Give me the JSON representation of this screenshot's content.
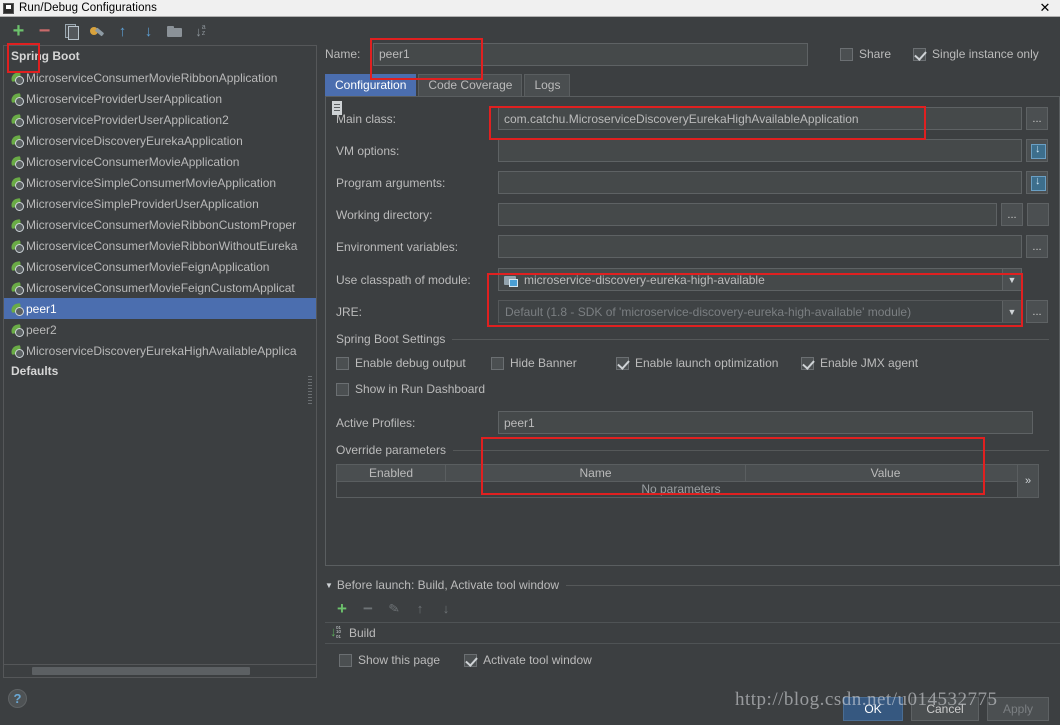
{
  "window": {
    "title": "Run/Debug Configurations",
    "close_label": "✕",
    "icon": "app-icon"
  },
  "sidebar": {
    "toolbar": [
      {
        "name": "add-configuration",
        "glyph": "+"
      },
      {
        "name": "remove-configuration",
        "glyph": "−"
      },
      {
        "name": "copy-configuration",
        "glyph": ""
      },
      {
        "name": "edit-templates",
        "glyph": ""
      },
      {
        "name": "move-up",
        "glyph": "↑"
      },
      {
        "name": "move-down",
        "glyph": "↓"
      },
      {
        "name": "create-folder",
        "glyph": ""
      },
      {
        "name": "sort-configurations",
        "glyph": "↓"
      }
    ],
    "groups": [
      {
        "label": "Spring Boot",
        "items": [
          {
            "label": "MicroserviceConsumerMovieRibbonApplication",
            "selected": false
          },
          {
            "label": "MicroserviceProviderUserApplication",
            "selected": false
          },
          {
            "label": "MicroserviceProviderUserApplication2",
            "selected": false
          },
          {
            "label": "MicroserviceDiscoveryEurekaApplication",
            "selected": false
          },
          {
            "label": "MicroserviceConsumerMovieApplication",
            "selected": false
          },
          {
            "label": "MicroserviceSimpleConsumerMovieApplication",
            "selected": false
          },
          {
            "label": "MicroserviceSimpleProviderUserApplication",
            "selected": false
          },
          {
            "label": "MicroserviceConsumerMovieRibbonCustomProper",
            "selected": false
          },
          {
            "label": "MicroserviceConsumerMovieRibbonWithoutEureka",
            "selected": false
          },
          {
            "label": "MicroserviceConsumerMovieFeignApplication",
            "selected": false
          },
          {
            "label": "MicroserviceConsumerMovieFeignCustomApplicat",
            "selected": false
          },
          {
            "label": "peer1",
            "selected": true
          },
          {
            "label": "peer2",
            "selected": false
          },
          {
            "label": "MicroserviceDiscoveryEurekaHighAvailableApplica",
            "selected": false
          }
        ]
      },
      {
        "label": "Defaults",
        "items": []
      }
    ]
  },
  "header": {
    "name_label": "Name:",
    "name_value": "peer1",
    "share_label": "Share",
    "share_checked": false,
    "single_instance_label": "Single instance only",
    "single_instance_checked": true
  },
  "tabs": [
    {
      "label": "Configuration",
      "active": true
    },
    {
      "label": "Code Coverage",
      "active": false
    },
    {
      "label": "Logs",
      "active": false
    }
  ],
  "configuration": {
    "main_class_label": "Main class:",
    "main_class_value": "com.catchu.MicroserviceDiscoveryEurekaHighAvailableApplication",
    "main_class_browse": "...",
    "vm_options_label": "VM options:",
    "vm_options_value": "",
    "program_arguments_label": "Program arguments:",
    "program_arguments_value": "",
    "working_directory_label": "Working directory:",
    "working_directory_value": "",
    "working_directory_browse": "...",
    "environment_variables_label": "Environment variables:",
    "environment_variables_value": "",
    "environment_variables_browse": "...",
    "classpath_label": "Use classpath of module:",
    "classpath_value": "microservice-discovery-eureka-high-available",
    "jre_label": "JRE:",
    "jre_value": "Default (1.8 - SDK of 'microservice-discovery-eureka-high-available' module)",
    "jre_browse": "...",
    "dropdown_glyph": "▼"
  },
  "spring_boot_settings": {
    "title": "Spring Boot Settings",
    "checkboxes": [
      {
        "label": "Enable debug output",
        "checked": false
      },
      {
        "label": "Hide Banner",
        "checked": false
      },
      {
        "label": "Enable launch optimization",
        "checked": true
      },
      {
        "label": "Enable JMX agent",
        "checked": true
      }
    ],
    "dashboard": {
      "label": "Show in Run Dashboard",
      "checked": false
    },
    "active_profiles_label": "Active Profiles:",
    "active_profiles_value": "peer1",
    "override_parameters_title": "Override parameters",
    "table": {
      "columns": [
        "Enabled",
        "Name",
        "Value"
      ],
      "empty_text": "No parameters",
      "expand_glyph": "»"
    }
  },
  "before_launch": {
    "title": "Before launch: Build, Activate tool window",
    "collapse_glyph": "▼",
    "toolbar": [
      {
        "name": "add-task",
        "glyph": "+"
      },
      {
        "name": "remove-task",
        "glyph": "−"
      },
      {
        "name": "edit-task",
        "glyph": "✎"
      },
      {
        "name": "task-move-up",
        "glyph": "↑"
      },
      {
        "name": "task-move-down",
        "glyph": "↓"
      }
    ],
    "tasks": [
      {
        "label": "Build"
      }
    ],
    "show_this_page": {
      "label": "Show this page",
      "checked": false
    },
    "activate_tool_window": {
      "label": "Activate tool window",
      "checked": true
    }
  },
  "footer": {
    "help_glyph": "?",
    "ok_label": "OK",
    "cancel_label": "Cancel",
    "apply_label": "Apply"
  },
  "watermark": {
    "text": "http://blog.csdn.net/u014532775"
  },
  "annotations": {
    "accent_color": "#e02020",
    "boxes": [
      {
        "name": "add-configuration-highlight"
      },
      {
        "name": "name-field-highlight"
      },
      {
        "name": "main-class-highlight"
      },
      {
        "name": "classpath-module-highlight"
      },
      {
        "name": "active-profiles-highlight"
      }
    ]
  }
}
